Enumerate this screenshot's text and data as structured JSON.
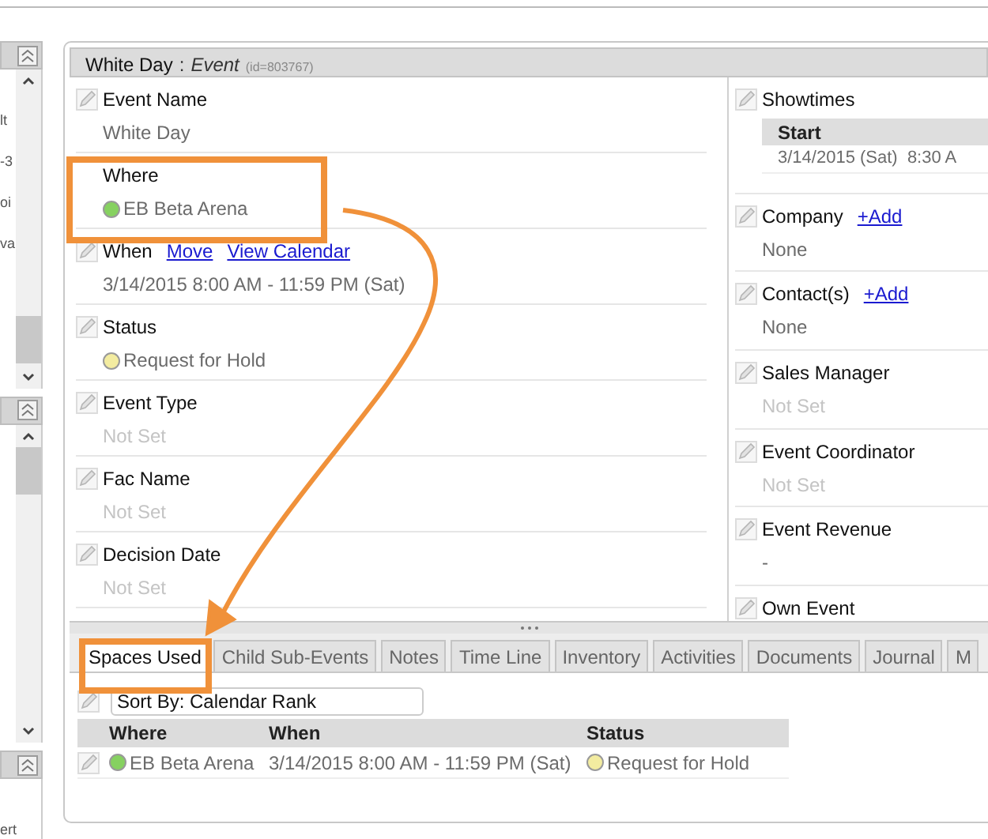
{
  "sidebar": {
    "panels": [
      {
        "kind": "scroll",
        "texts": [
          "lt",
          "-3",
          "oi",
          "va"
        ]
      },
      {
        "kind": "scroll"
      },
      {
        "kind": "plain",
        "texts": [
          "ert"
        ]
      }
    ]
  },
  "event": {
    "title": "White Day",
    "separator": ":",
    "type": "Event",
    "id": "(id=803767)"
  },
  "left_fields": [
    {
      "label": "Event Name",
      "editable": true,
      "kind": "text",
      "value": "White Day"
    },
    {
      "label": "Where",
      "editable": false,
      "kind": "status",
      "value": "EB Beta Arena",
      "color": "#86d160"
    },
    {
      "label": "When",
      "editable": true,
      "kind": "text",
      "links": [
        "Move",
        "View Calendar"
      ],
      "value": "3/14/2015 8:00 AM - 11:59 PM (Sat)"
    },
    {
      "label": "Status",
      "editable": true,
      "kind": "status",
      "value": "Request for Hold",
      "color": "#f3eca0"
    },
    {
      "label": "Event Type",
      "editable": true,
      "kind": "unset",
      "value": "Not Set"
    },
    {
      "label": "Fac Name",
      "editable": true,
      "kind": "unset",
      "value": "Not Set"
    },
    {
      "label": "Decision Date",
      "editable": true,
      "kind": "unset",
      "value": "Not Set"
    }
  ],
  "right_fields": [
    {
      "label": "Showtimes",
      "editable": true,
      "kind": "table",
      "columns": [
        "Start"
      ],
      "rows": [
        [
          "3/14/2015 (Sat)  8:30 A"
        ]
      ]
    },
    {
      "label": "Company",
      "editable": true,
      "kind": "text",
      "links": [
        "+Add"
      ],
      "value": "None"
    },
    {
      "label": "Contact(s)",
      "editable": true,
      "kind": "text",
      "links": [
        "+Add"
      ],
      "value": "None"
    },
    {
      "label": "Sales Manager",
      "editable": true,
      "kind": "unset",
      "value": "Not Set"
    },
    {
      "label": "Event Coordinator",
      "editable": true,
      "kind": "unset",
      "value": "Not Set"
    },
    {
      "label": "Event Revenue",
      "editable": true,
      "kind": "text",
      "value": "-"
    },
    {
      "label": "Own Event",
      "editable": true,
      "kind": "label"
    }
  ],
  "tabs": [
    {
      "label": "Spaces Used",
      "selected": true
    },
    {
      "label": "Child Sub-Events",
      "selected": false
    },
    {
      "label": "Notes",
      "selected": false
    },
    {
      "label": "Time Line",
      "selected": false
    },
    {
      "label": "Inventory",
      "selected": false
    },
    {
      "label": "Activities",
      "selected": false
    },
    {
      "label": "Documents",
      "selected": false
    },
    {
      "label": "Journal",
      "selected": false
    },
    {
      "label": "M",
      "selected": false
    }
  ],
  "sort": {
    "value": "Sort By: Calendar Rank"
  },
  "spaces": {
    "columns": [
      "Where",
      "When",
      "Status"
    ],
    "rows": [
      {
        "cells": [
          {
            "text": "EB Beta Arena",
            "color": "#86d160"
          },
          {
            "text": "3/14/2015 8:00 AM - 11:59 PM (Sat)"
          },
          {
            "text": "Request for Hold",
            "color": "#f3eca0"
          }
        ]
      }
    ]
  }
}
